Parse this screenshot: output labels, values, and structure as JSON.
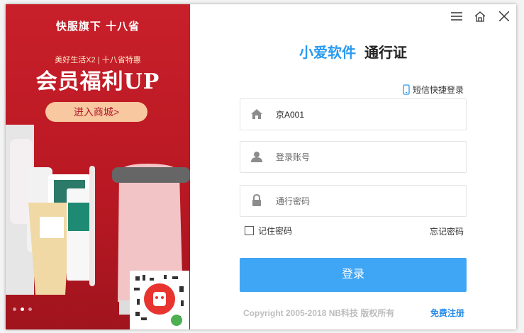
{
  "ad": {
    "brand": "快服旗下 十八省",
    "tagline": "美好生活X2 | 十八省特惠",
    "headline": "会员福利UP",
    "cta": "进入商城>",
    "carousel_pages": 3,
    "carousel_active_index": 1
  },
  "window_controls": {
    "menu_icon": "hamburger-icon",
    "home_icon": "home-icon",
    "close_icon": "close-icon"
  },
  "header": {
    "app_name": "小爱软件",
    "pass_name": "通行证"
  },
  "sms_login": {
    "icon": "phone-icon",
    "label": "短信快捷登录"
  },
  "fields": {
    "org": {
      "icon": "home-icon",
      "value": "京A001"
    },
    "account": {
      "icon": "user-icon",
      "placeholder": "登录账号"
    },
    "password": {
      "icon": "lock-icon",
      "placeholder": "通行密码"
    }
  },
  "remember": {
    "label": "记住密码",
    "checked": false
  },
  "forgot_label": "忘记密码",
  "login_label": "登录",
  "copyright": "Copyright 2005-2018 NB科技 版权所有",
  "register_label": "免费注册",
  "colors": {
    "accent": "#3fa5f5",
    "link": "#2a8ee8",
    "ad_red": "#c8202a"
  }
}
